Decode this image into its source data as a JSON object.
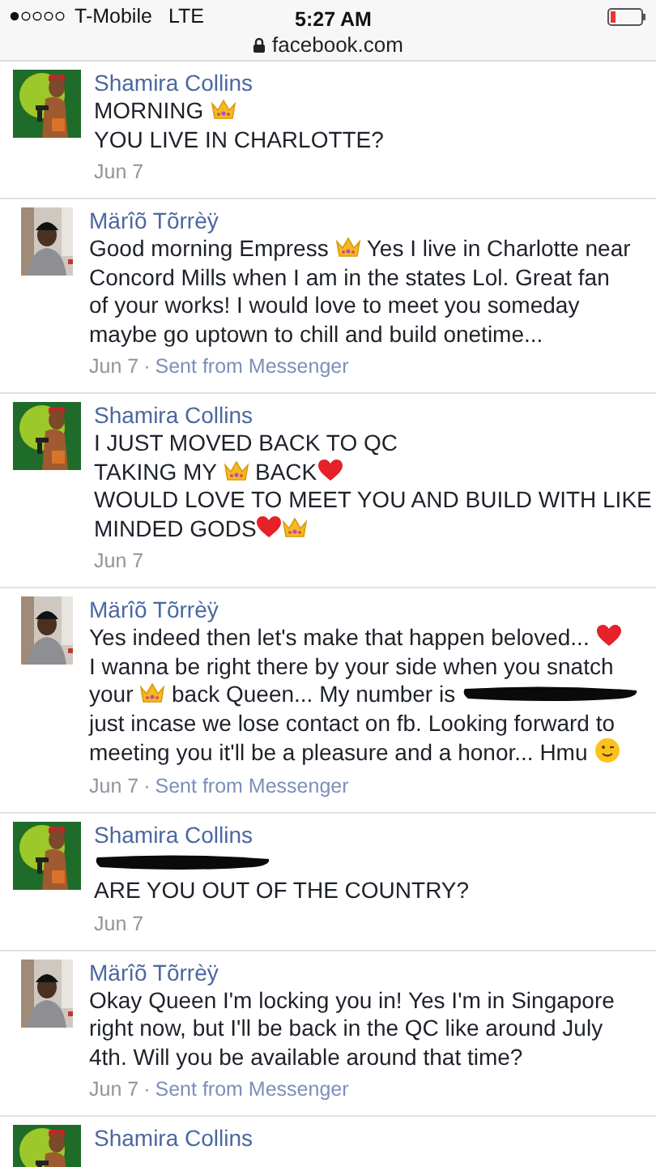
{
  "status_bar": {
    "carrier": "T-Mobile",
    "network": "LTE",
    "time": "5:27 AM",
    "url": "facebook.com"
  },
  "messages": [
    {
      "sender": "Shamira Collins",
      "avatar": {
        "kind": "picture"
      },
      "lines": [
        [
          {
            "kind": "text",
            "text": "MORNING "
          },
          {
            "kind": "crown"
          }
        ],
        [
          {
            "kind": "text",
            "text": "YOU LIVE IN CHARLOTTE?"
          }
        ]
      ],
      "date": "Jun 7"
    },
    {
      "sender": "Märîõ Tõrrèÿ",
      "avatar": {
        "kind": "picture"
      },
      "lines": [
        [
          {
            "kind": "text",
            "text": "Good morning Empress "
          },
          {
            "kind": "crown"
          },
          {
            "kind": "text",
            "text": " Yes I live in Charlotte near"
          }
        ],
        [
          {
            "kind": "text",
            "text": "Concord Mills when I am in the states Lol. Great fan"
          }
        ],
        [
          {
            "kind": "text",
            "text": "of your works! I would love to meet you someday"
          }
        ],
        [
          {
            "kind": "text",
            "text": "maybe go uptown to chill and build onetime..."
          }
        ]
      ],
      "date": "Jun 7",
      "separator": "·",
      "via": "Sent from Messenger"
    },
    {
      "sender": "Shamira Collins",
      "avatar": {
        "kind": "picture"
      },
      "lines": [
        [
          {
            "kind": "text",
            "text": "I JUST MOVED BACK TO QC"
          }
        ],
        [
          {
            "kind": "text",
            "text": "TAKING MY "
          },
          {
            "kind": "crown"
          },
          {
            "kind": "text",
            "text": " BACK"
          },
          {
            "kind": "heart"
          }
        ],
        [
          {
            "kind": "text",
            "text": "WOULD LOVE TO MEET YOU AND BUILD WITH LIKE"
          }
        ],
        [
          {
            "kind": "text",
            "text": "MINDED GODS"
          },
          {
            "kind": "heart"
          },
          {
            "kind": "crown"
          }
        ]
      ],
      "date": "Jun 7"
    },
    {
      "sender": "Märîõ Tõrrèÿ",
      "avatar": {
        "kind": "picture"
      },
      "lines": [
        [
          {
            "kind": "text",
            "text": "Yes indeed then let's make that happen beloved... "
          },
          {
            "kind": "heart"
          }
        ],
        [
          {
            "kind": "text",
            "text": "I wanna be right there by your side when you snatch"
          }
        ],
        [
          {
            "kind": "text",
            "text": "your "
          },
          {
            "kind": "crown"
          },
          {
            "kind": "text",
            "text": " back Queen... My number is "
          },
          {
            "kind": "redaction"
          }
        ],
        [
          {
            "kind": "text",
            "text": "just incase we lose contact on fb. Looking forward to"
          }
        ],
        [
          {
            "kind": "text",
            "text": "meeting you it'll be a pleasure and a honor... Hmu "
          },
          {
            "kind": "wink"
          }
        ]
      ],
      "date": "Jun 7",
      "separator": "·",
      "via": "Sent from Messenger"
    },
    {
      "sender": "Shamira Collins",
      "avatar": {
        "kind": "picture"
      },
      "lines": [
        [
          {
            "kind": "redaction"
          }
        ],
        [
          {
            "kind": "text",
            "text": "ARE YOU OUT OF THE COUNTRY?"
          }
        ]
      ],
      "date": "Jun 7"
    },
    {
      "sender": "Märîõ Tõrrèÿ",
      "avatar": {
        "kind": "picture"
      },
      "lines": [
        [
          {
            "kind": "text",
            "text": "Okay Queen I'm locking you in! Yes I'm in Singapore"
          }
        ],
        [
          {
            "kind": "text",
            "text": "right now, but I'll be back in the QC like around July"
          }
        ],
        [
          {
            "kind": "text",
            "text": "4th. Will you be available around that time?"
          }
        ]
      ],
      "date": "Jun 7",
      "separator": "·",
      "via": "Sent from Messenger"
    },
    {
      "sender": "Shamira Collins",
      "avatar": {
        "kind": "picture"
      }
    }
  ]
}
